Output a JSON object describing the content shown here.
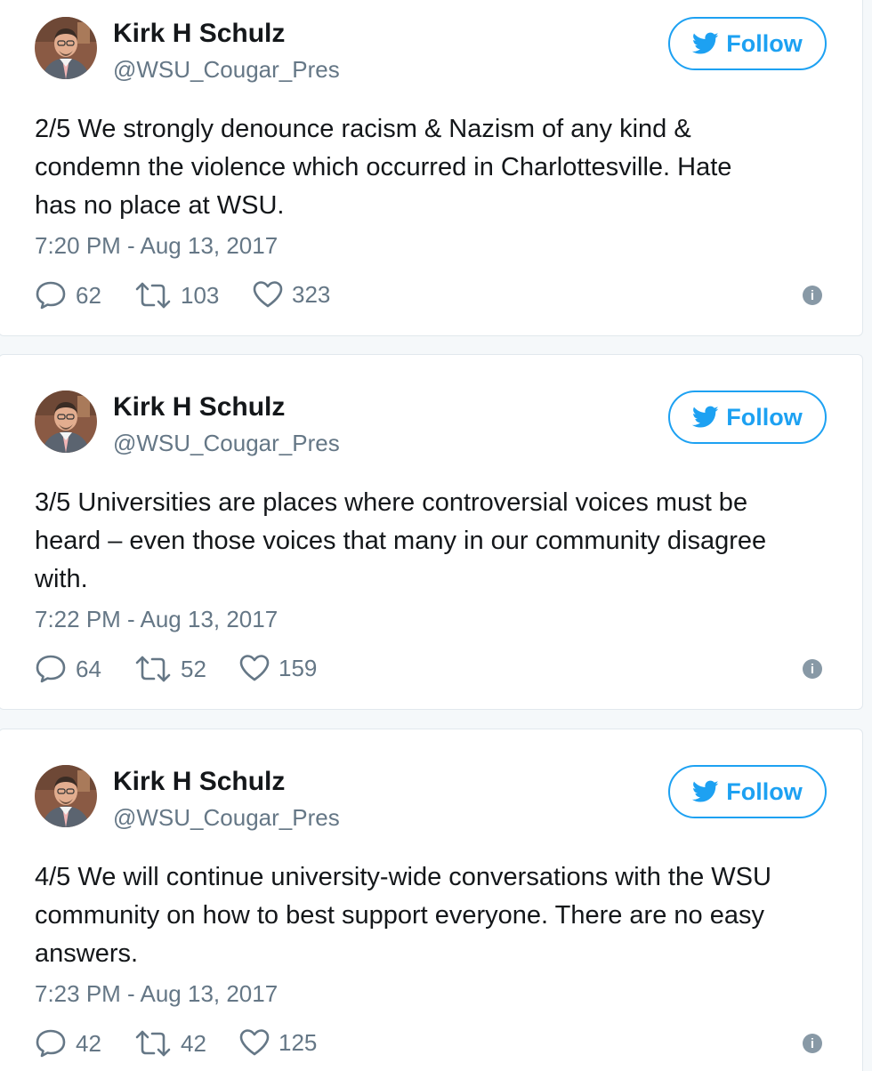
{
  "colors": {
    "accent": "#1da1f2",
    "text_primary": "#14171a",
    "text_secondary": "#657786",
    "border": "#e1e8ed",
    "background": "#f5f8fa"
  },
  "icons": {
    "reply": "speech-bubble-icon",
    "retweet": "retweet-arrows-icon",
    "like": "heart-icon",
    "info": "info-icon",
    "follow": "twitter-bird-icon"
  },
  "tweets": [
    {
      "author_name": "Kirk H Schulz",
      "author_handle": "@WSU_Cougar_Pres",
      "follow_label": "Follow",
      "text": "2/5 We strongly denounce racism & Nazism of any kind &\ncondemn the violence which occurred in Charlottesville. Hate\nhas no place at WSU.",
      "timestamp": "7:20 PM - Aug 13, 2017",
      "replies": "62",
      "retweets": "103",
      "likes": "323",
      "info_label": "i"
    },
    {
      "author_name": "Kirk H Schulz",
      "author_handle": "@WSU_Cougar_Pres",
      "follow_label": "Follow",
      "text": "3/5 Universities are places where controversial voices must be\nheard – even those voices that many in our community disagree\nwith.",
      "timestamp": "7:22 PM - Aug 13, 2017",
      "replies": "64",
      "retweets": "52",
      "likes": "159",
      "info_label": "i"
    },
    {
      "author_name": "Kirk H Schulz",
      "author_handle": "@WSU_Cougar_Pres",
      "follow_label": "Follow",
      "text": "4/5 We will continue university-wide conversations with the WSU\ncommunity on how to best support everyone. There are no easy\nanswers.",
      "timestamp": "7:23 PM - Aug 13, 2017",
      "replies": "42",
      "retweets": "42",
      "likes": "125",
      "info_label": "i"
    }
  ]
}
